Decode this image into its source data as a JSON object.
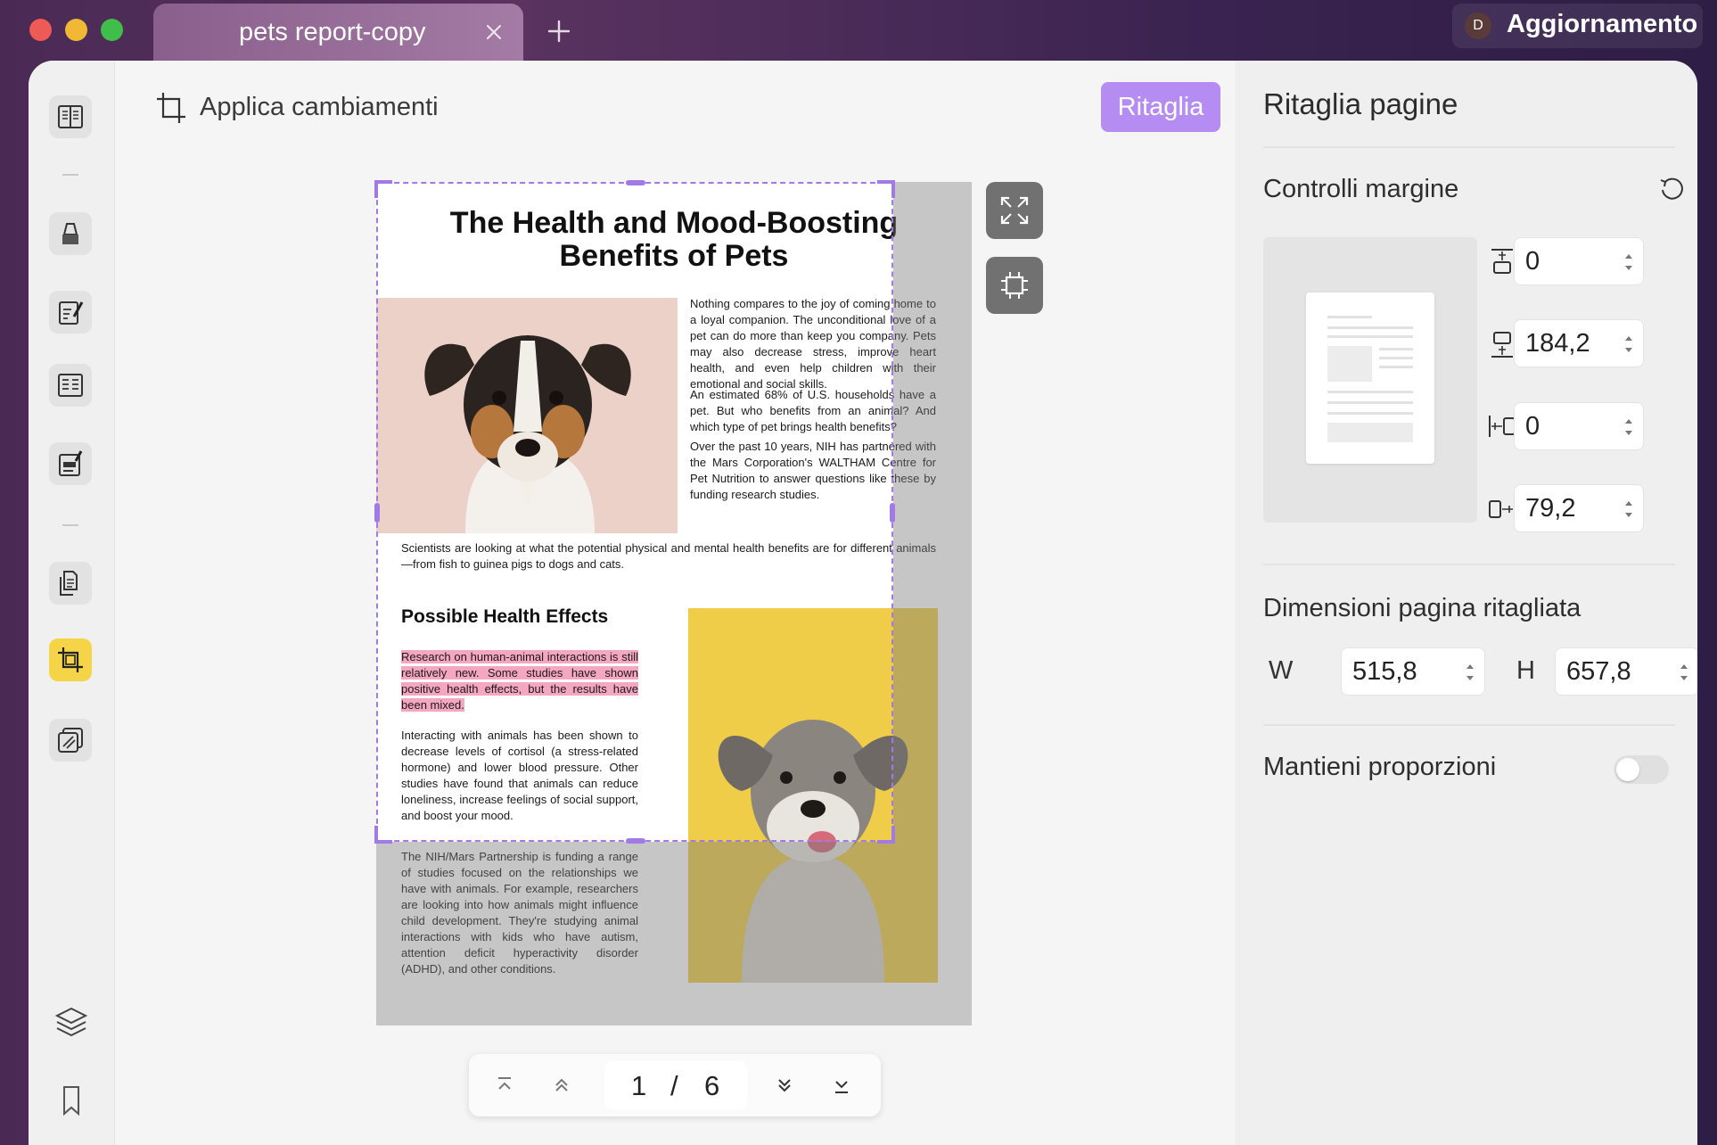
{
  "tab": {
    "title": "pets report-copy"
  },
  "update": {
    "avatar": "D",
    "label": "Aggiornamento"
  },
  "toolbar": {
    "apply_label": "Applica cambiamenti",
    "crop_button": "Ritaglia"
  },
  "document": {
    "title": "The Health and Mood-Boosting Benefits of Pets",
    "para1": "Nothing compares to the joy of coming home to a loyal companion. The unconditional love of a pet can do more than keep you company. Pets may also decrease stress, improve heart health, and even help children with their emotional and social skills.",
    "para2": "An estimated 68% of U.S. households have a pet. But who benefits from an animal? And which type of pet brings health benefits?",
    "para3": "Over the past 10 years, NIH has partnered with the Mars Corporation's WALTHAM Centre for Pet Nutrition to answer questions like these by funding research studies.",
    "para4": "Scientists are looking at what the potential physical and mental health benefits are for different animals—from fish to guinea pigs to dogs and cats.",
    "heading2": "Possible Health Effects",
    "highlight": "Research on human-animal interactions is still relatively new. Some studies have shown positive health effects, but the results have been mixed.",
    "para5": "Interacting with animals has been shown to decrease levels of cortisol (a stress-related hormone) and lower blood pressure. Other studies have found that animals can reduce loneliness, increase feelings of social support, and boost your mood.",
    "para6": "The NIH/Mars Partnership is funding a range of studies focused on the relationships we have with animals. For example, researchers are looking into how animals might influence child development. They're studying animal interactions with kids who have autism, attention deficit hyperactivity disorder (ADHD), and other conditions."
  },
  "pagenav": {
    "current": "1",
    "separator": "/",
    "total": "6"
  },
  "panel": {
    "title": "Ritaglia pagine",
    "margins_heading": "Controlli margine",
    "margin_top": "0",
    "margin_bottom": "184,2",
    "margin_left": "0",
    "margin_right": "79,2",
    "size_heading": "Dimensioni pagina ritagliata",
    "width_label": "W",
    "width_value": "515,8",
    "height_label": "H",
    "height_value": "657,8",
    "keep_ratio_label": "Mantieni proporzioni",
    "keep_ratio_on": false
  },
  "colors": {
    "accent": "#b58cf2",
    "crop_border": "#a27ae6",
    "active_tool": "#f5d547",
    "highlight": "#f5a7c1"
  },
  "icons": [
    "close-icon",
    "plus-icon",
    "reader-icon",
    "highlighter-icon",
    "edit-icon",
    "form-icon",
    "sign-icon",
    "organize-icon",
    "crop-icon",
    "watermark-icon",
    "layers-icon",
    "bookmark-icon",
    "reset-icon",
    "fullscreen-icon",
    "fit-crop-icon",
    "first-page-icon",
    "prev-page-icon",
    "next-page-icon",
    "last-page-icon"
  ]
}
